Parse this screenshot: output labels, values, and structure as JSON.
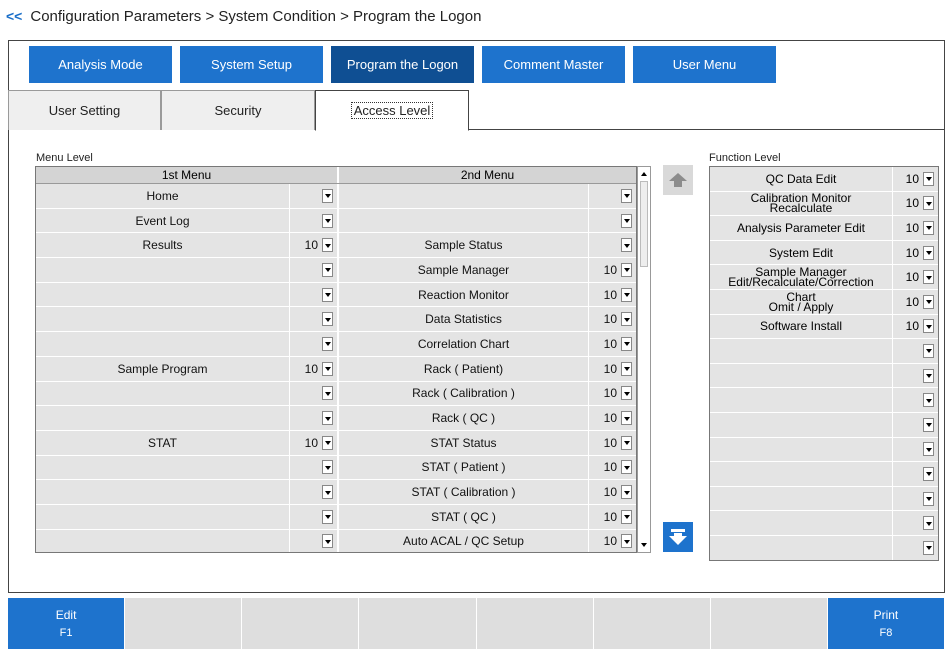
{
  "breadcrumb": {
    "back_label": "<<",
    "path": "Configuration Parameters > System Condition > Program the Logon"
  },
  "main_tabs": [
    {
      "label": "Analysis Mode",
      "active": false
    },
    {
      "label": "System Setup",
      "active": false
    },
    {
      "label": "Program the Logon",
      "active": true
    },
    {
      "label": "Comment Master",
      "active": false
    },
    {
      "label": "User Menu",
      "active": false
    }
  ],
  "sub_tabs": [
    {
      "label": "User Setting",
      "active": false
    },
    {
      "label": "Security",
      "active": false
    },
    {
      "label": "Access Level",
      "active": true
    }
  ],
  "menu_level": {
    "title": "Menu Level",
    "col1_header": "1st Menu",
    "col2_header": "2nd Menu",
    "rows": [
      {
        "first": "Home",
        "first_val": "",
        "second": "",
        "second_val": ""
      },
      {
        "first": "Event Log",
        "first_val": "",
        "second": "",
        "second_val": ""
      },
      {
        "first": "Results",
        "first_val": "10",
        "second": "Sample Status",
        "second_val": ""
      },
      {
        "first": "",
        "first_val": "",
        "second": "Sample Manager",
        "second_val": "10"
      },
      {
        "first": "",
        "first_val": "",
        "second": "Reaction Monitor",
        "second_val": "10"
      },
      {
        "first": "",
        "first_val": "",
        "second": "Data Statistics",
        "second_val": "10"
      },
      {
        "first": "",
        "first_val": "",
        "second": "Correlation Chart",
        "second_val": "10"
      },
      {
        "first": "Sample Program",
        "first_val": "10",
        "second": "Rack ( Patient)",
        "second_val": "10"
      },
      {
        "first": "",
        "first_val": "",
        "second": "Rack ( Calibration )",
        "second_val": "10"
      },
      {
        "first": "",
        "first_val": "",
        "second": "Rack ( QC )",
        "second_val": "10"
      },
      {
        "first": "STAT",
        "first_val": "10",
        "second": "STAT Status",
        "second_val": "10"
      },
      {
        "first": "",
        "first_val": "",
        "second": "STAT ( Patient )",
        "second_val": "10"
      },
      {
        "first": "",
        "first_val": "",
        "second": "STAT ( Calibration )",
        "second_val": "10"
      },
      {
        "first": "",
        "first_val": "",
        "second": "STAT ( QC )",
        "second_val": "10"
      },
      {
        "first": "",
        "first_val": "",
        "second": "Auto ACAL / QC Setup",
        "second_val": "10"
      }
    ]
  },
  "function_level": {
    "title": "Function Level",
    "rows": [
      {
        "name": "QC Data Edit",
        "val": "10"
      },
      {
        "name": "Calibration Monitor\nRecalculate",
        "val": "10"
      },
      {
        "name": "Analysis Parameter Edit",
        "val": "10"
      },
      {
        "name": "System Edit",
        "val": "10"
      },
      {
        "name": "Sample Manager\nEdit/Recalculate/Correction",
        "val": "10"
      },
      {
        "name": "Chart\nOmit / Apply",
        "val": "10"
      },
      {
        "name": "Software Install",
        "val": "10"
      },
      {
        "name": "",
        "val": ""
      },
      {
        "name": "",
        "val": ""
      },
      {
        "name": "",
        "val": ""
      },
      {
        "name": "",
        "val": ""
      },
      {
        "name": "",
        "val": ""
      },
      {
        "name": "",
        "val": ""
      },
      {
        "name": "",
        "val": ""
      },
      {
        "name": "",
        "val": ""
      },
      {
        "name": "",
        "val": ""
      }
    ]
  },
  "function_keys": [
    {
      "label": "Edit",
      "key": "F1",
      "active": true
    },
    {
      "label": "",
      "key": "",
      "active": false
    },
    {
      "label": "",
      "key": "",
      "active": false
    },
    {
      "label": "",
      "key": "",
      "active": false
    },
    {
      "label": "",
      "key": "",
      "active": false
    },
    {
      "label": "",
      "key": "",
      "active": false
    },
    {
      "label": "",
      "key": "",
      "active": false
    },
    {
      "label": "Print",
      "key": "F8",
      "active": true
    }
  ],
  "colors": {
    "accent": "#1e73cd",
    "accent_active": "#0f4f93",
    "cell_bg": "#e4e4e4"
  }
}
